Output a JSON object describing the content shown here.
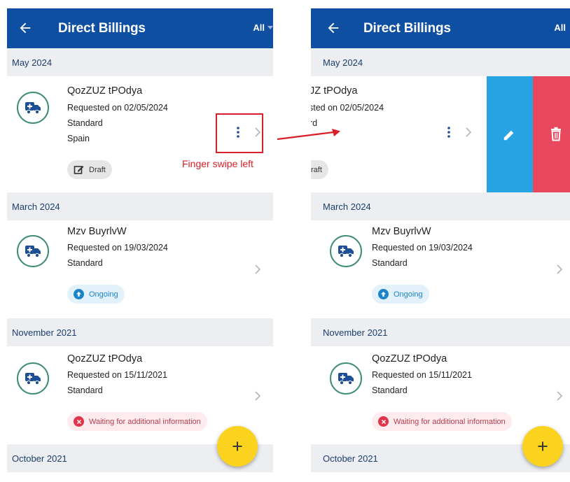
{
  "appbar": {
    "title": "Direct Billings",
    "filter_label": "All",
    "back_icon": "arrow-left-icon"
  },
  "colors": {
    "appbar": "#0f4fa1",
    "edit": "#26a4e3",
    "delete": "#e8485e",
    "fab": "#fbd21e",
    "avatar_ring": "#3e8e6d"
  },
  "sections": [
    {
      "label": "May 2024"
    },
    {
      "label": "March 2024"
    },
    {
      "label": "November 2021"
    },
    {
      "label": "October 2021"
    }
  ],
  "items": [
    {
      "name": "QozZUZ tPOdya",
      "requested": "Requested on 02/05/2024",
      "type": "Standard",
      "country": "Spain",
      "status": "Draft",
      "status_icon": "edit-icon"
    },
    {
      "name": "Mzv BuyrlvW",
      "requested": "Requested on 19/03/2024",
      "type": "Standard",
      "status": "Ongoing",
      "status_icon": "arrow-up-icon"
    },
    {
      "name": "QozZUZ tPOdya",
      "requested": "Requested on 15/11/2021",
      "type": "Standard",
      "status": "Waiting for additional information",
      "status_icon": "close-icon"
    }
  ],
  "swiped": {
    "name": "JZ tPOdya",
    "requested": "sted on 02/05/2024",
    "type": "rd",
    "status": "raft"
  },
  "annotation": {
    "label": "Finger swipe left"
  },
  "fab": {
    "label": "+"
  }
}
